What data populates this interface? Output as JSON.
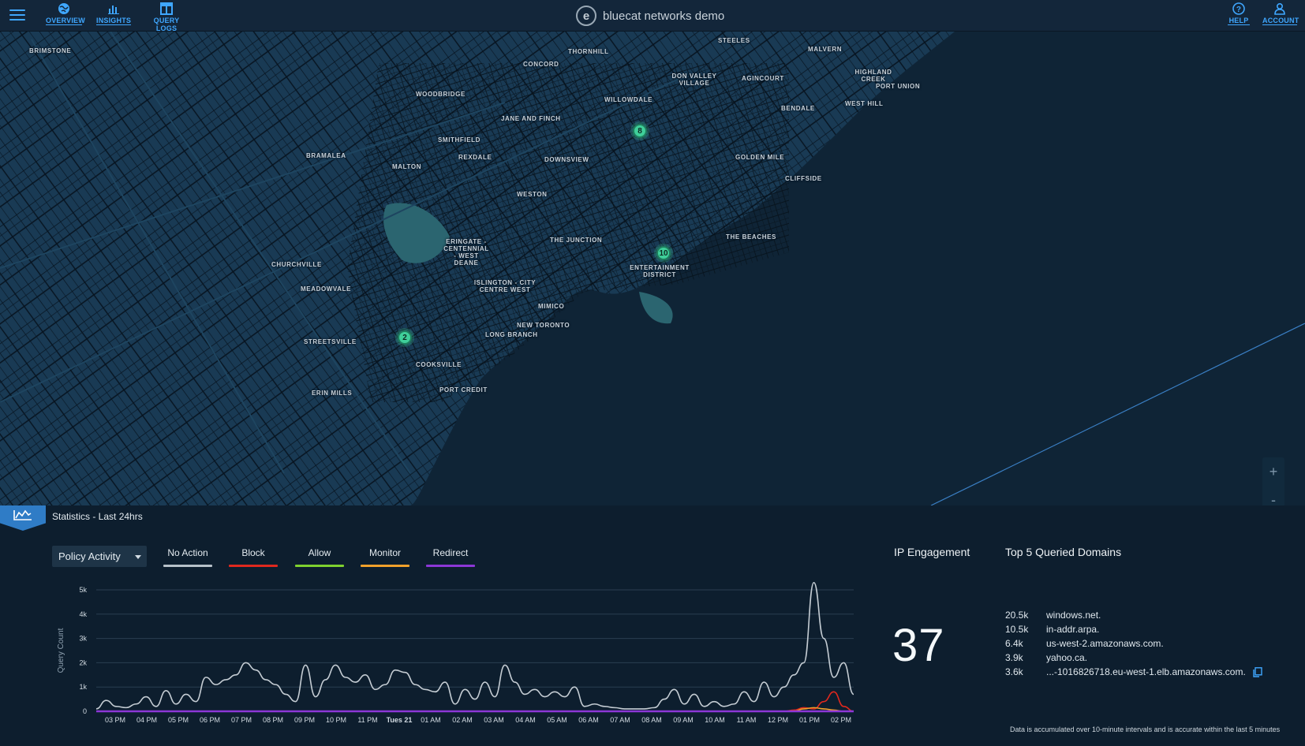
{
  "app": {
    "brand": "bluecat networks demo",
    "brand_logo_letter": "e"
  },
  "nav": {
    "overview": "OVERVIEW",
    "insights": "INSIGHTS",
    "query_logs": "QUERY LOGS",
    "help": "HELP",
    "account": "ACCOUNT"
  },
  "map": {
    "places": [
      "BRIMSTONE",
      "THORNHILL",
      "STEELES",
      "MALVERN",
      "CONCORD",
      "DON VALLEY VILLAGE",
      "AGINCOURT",
      "HIGHLAND CREEK",
      "PORT UNION",
      "WOODBRIDGE",
      "WILLOWDALE",
      "BENDALE",
      "WEST HILL",
      "JANE AND FINCH",
      "SMITHFIELD",
      "BRAMALEA",
      "REXDALE",
      "DOWNSVIEW",
      "GOLDEN MILE",
      "MALTON",
      "CLIFFSIDE",
      "WESTON",
      "ERINGATE - CENTENNIAL - WEST DEANE",
      "THE JUNCTION",
      "THE BEACHES",
      "CHURCHVILLE",
      "ENTERTAINMENT DISTRICT",
      "ISLINGTON - CITY CENTRE WEST",
      "MEADOWVALE",
      "MIMICO",
      "NEW TORONTO",
      "LONG BRANCH",
      "STREETSVILLE",
      "COOKSVILLE",
      "PORT CREDIT",
      "ERIN MILLS"
    ],
    "clusters": [
      "8",
      "10",
      "2"
    ],
    "zoom_in": "+",
    "zoom_out": "-"
  },
  "stats": {
    "title": "Statistics - Last 24hrs",
    "selector": "Policy Activity",
    "legend": [
      {
        "label": "No Action",
        "color": "#b7c1c9"
      },
      {
        "label": "Block",
        "color": "#e0281e"
      },
      {
        "label": "Allow",
        "color": "#7fd12f"
      },
      {
        "label": "Monitor",
        "color": "#f0a12b"
      },
      {
        "label": "Redirect",
        "color": "#8c37d6"
      }
    ]
  },
  "chart_data": {
    "type": "line",
    "ylabel": "Query Count",
    "yticks": [
      "5k",
      "4k",
      "3k",
      "2k",
      "1k",
      "0"
    ],
    "ylim": [
      0,
      5000
    ],
    "grid": true,
    "x": [
      "03 PM",
      "04 PM",
      "05 PM",
      "06 PM",
      "07 PM",
      "08 PM",
      "09 PM",
      "10 PM",
      "11 PM",
      "Tues 21",
      "01 AM",
      "02 AM",
      "03 AM",
      "04 AM",
      "05 AM",
      "06 AM",
      "07 AM",
      "08 AM",
      "09 AM",
      "10 AM",
      "11 AM",
      "12 PM",
      "01 PM",
      "02 PM"
    ],
    "series": [
      {
        "name": "No Action",
        "color": "#c4ccd3",
        "values": [
          100,
          450,
          200,
          150,
          300,
          600,
          200,
          850,
          300,
          700,
          400,
          1400,
          1100,
          1300,
          1500,
          2000,
          1700,
          1300,
          1100,
          700,
          400,
          1900,
          600,
          1300,
          1900,
          1400,
          1200,
          1500,
          900,
          1100,
          1700,
          1600,
          1100,
          900,
          800,
          1200,
          300,
          900,
          500,
          1200,
          600,
          1900,
          1200,
          700,
          900,
          600,
          800,
          600,
          1000,
          200,
          300,
          200,
          150,
          100,
          100,
          100,
          150,
          500,
          900,
          300,
          700,
          200,
          400,
          200,
          300,
          800,
          400,
          1200,
          600,
          1000,
          1500,
          2000,
          5300,
          3000,
          1400,
          2000,
          700
        ]
      },
      {
        "name": "Block",
        "color": "#e0281e",
        "values": [
          0,
          0,
          0,
          0,
          0,
          0,
          0,
          0,
          0,
          0,
          0,
          0,
          0,
          0,
          0,
          0,
          0,
          0,
          0,
          0,
          0,
          0,
          0,
          0,
          0,
          0,
          0,
          0,
          0,
          0,
          0,
          0,
          0,
          0,
          0,
          0,
          0,
          0,
          0,
          0,
          0,
          0,
          0,
          0,
          0,
          0,
          0,
          0,
          0,
          0,
          0,
          0,
          0,
          0,
          0,
          0,
          0,
          0,
          0,
          0,
          0,
          0,
          0,
          0,
          0,
          0,
          0,
          0,
          0,
          0,
          50,
          150,
          100,
          400,
          800,
          200,
          0
        ]
      },
      {
        "name": "Monitor",
        "color": "#f0a12b",
        "values": [
          0,
          0,
          0,
          0,
          0,
          0,
          0,
          0,
          0,
          0,
          0,
          0,
          0,
          0,
          0,
          0,
          0,
          0,
          0,
          0,
          0,
          0,
          0,
          0,
          0,
          0,
          0,
          0,
          0,
          0,
          0,
          0,
          0,
          0,
          0,
          0,
          0,
          0,
          0,
          0,
          0,
          0,
          0,
          0,
          0,
          0,
          0,
          0,
          0,
          0,
          0,
          0,
          0,
          0,
          0,
          0,
          0,
          0,
          0,
          0,
          0,
          0,
          0,
          0,
          0,
          0,
          0,
          0,
          0,
          0,
          0,
          100,
          150,
          100,
          50,
          0,
          0
        ]
      },
      {
        "name": "Redirect",
        "color": "#8c37d6",
        "values": [
          0,
          0,
          0,
          0,
          0,
          0,
          0,
          0,
          0,
          0,
          0,
          0,
          0,
          0,
          0,
          0,
          0,
          0,
          0,
          0,
          0,
          0,
          0,
          0,
          0,
          0,
          0,
          0,
          0,
          0,
          0,
          0,
          0,
          0,
          0,
          0,
          0,
          0,
          0,
          0,
          0,
          0,
          0,
          0,
          0,
          0,
          0,
          0,
          0,
          0,
          0,
          0,
          0,
          0,
          0,
          0,
          0,
          0,
          0,
          0,
          0,
          0,
          0,
          0,
          0,
          0,
          0,
          0,
          0,
          0,
          0,
          0,
          0,
          0,
          0,
          0,
          0
        ]
      }
    ]
  },
  "ip_engagement": {
    "title": "IP Engagement",
    "value": "37"
  },
  "top_domains": {
    "title": "Top 5 Queried Domains",
    "rows": [
      {
        "count": "20.5k",
        "domain": "windows.net."
      },
      {
        "count": "10.5k",
        "domain": "in-addr.arpa."
      },
      {
        "count": "6.4k",
        "domain": "us-west-2.amazonaws.com."
      },
      {
        "count": "3.9k",
        "domain": "yahoo.ca."
      },
      {
        "count": "3.6k",
        "domain": "...-1016826718.eu-west-1.elb.amazonaws.com."
      }
    ]
  },
  "footnote": "Data is accumulated over 10-minute intervals and is accurate within the last 5 minutes"
}
